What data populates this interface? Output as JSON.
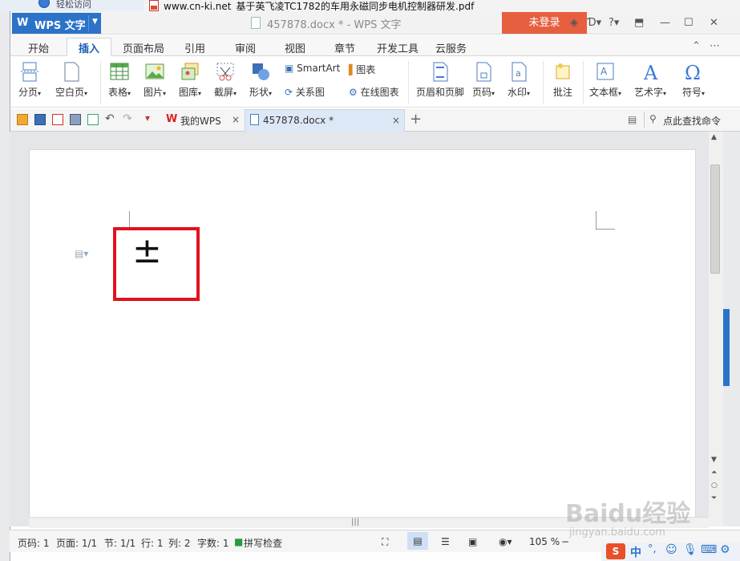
{
  "background": {
    "left_item": "轻松访问",
    "pdf_title": "www.cn-ki.net_基于英飞凌TC1782的车用永磁同步电机控制器研发.pdf"
  },
  "titlebar": {
    "app_name": "WPS 文字",
    "document_title": "457878.docx * - WPS 文字",
    "login": "未登录"
  },
  "tabs": [
    "开始",
    "插入",
    "页面布局",
    "引用",
    "审阅",
    "视图",
    "章节",
    "开发工具",
    "云服务"
  ],
  "active_tab": "插入",
  "ribbon": {
    "page_break": "分页",
    "blank_page": "空白页",
    "table": "表格",
    "picture": "图片",
    "gallery": "图库",
    "screenshot": "截屏",
    "shapes": "形状",
    "smartart": "SmartArt",
    "chart": "图表",
    "relation": "关系图",
    "online_chart": "在线图表",
    "header_footer": "页眉和页脚",
    "page_number": "页码",
    "watermark": "水印",
    "comment": "批注",
    "textbox": "文本框",
    "wordart": "艺术字",
    "symbol": "符号"
  },
  "doc_tabs": {
    "my_wps": "我的WPS",
    "document": "457878.docx *",
    "find_command": "点此查找命令"
  },
  "document": {
    "content": "±"
  },
  "status": {
    "page": "页码: 1",
    "pages": "页面: 1/1",
    "section": "节: 1/1",
    "row": "行: 1",
    "col": "列: 2",
    "words": "字数: 1",
    "spell": "拼写检查",
    "zoom": "105 %"
  },
  "watermark_text": {
    "brand": "Baidu经验",
    "url": "jingyan.baidu.com"
  },
  "tray": {
    "ime": "中"
  },
  "colors": {
    "accent": "#2b73c8",
    "login": "#e65f3e",
    "highlight": "#e0121e"
  }
}
